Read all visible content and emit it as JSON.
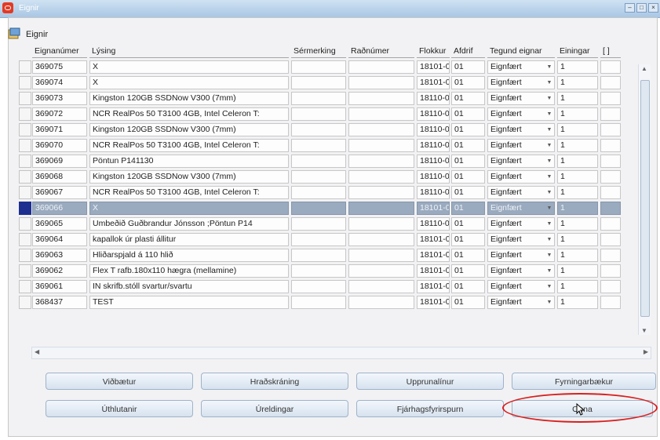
{
  "window": {
    "title": "Eignir"
  },
  "form": {
    "title": "Eignir"
  },
  "columns": [
    "Eignanúmer",
    "Lýsing",
    "Sérmerking",
    "Raðnúmer",
    "Flokkur",
    "Afdrif",
    "Tegund eignar",
    "Einingar",
    "[ ]"
  ],
  "rows": [
    {
      "num": "369075",
      "desc": "X",
      "ser": "",
      "rad": "",
      "flokkur": "18101-0",
      "afdrif": "01",
      "tegund": "Eignfært",
      "einingar": "1"
    },
    {
      "num": "369074",
      "desc": "X",
      "ser": "",
      "rad": "",
      "flokkur": "18101-0",
      "afdrif": "01",
      "tegund": "Eignfært",
      "einingar": "1"
    },
    {
      "num": "369073",
      "desc": "Kingston 120GB SSDNow V300 (7mm)",
      "ser": "",
      "rad": "",
      "flokkur": "18110-0",
      "afdrif": "01",
      "tegund": "Eignfært",
      "einingar": "1"
    },
    {
      "num": "369072",
      "desc": "NCR RealPos 50 T3100 4GB, Intel Celeron T:",
      "ser": "",
      "rad": "",
      "flokkur": "18110-0",
      "afdrif": "01",
      "tegund": "Eignfært",
      "einingar": "1"
    },
    {
      "num": "369071",
      "desc": "Kingston 120GB SSDNow V300 (7mm)",
      "ser": "",
      "rad": "",
      "flokkur": "18110-0",
      "afdrif": "01",
      "tegund": "Eignfært",
      "einingar": "1"
    },
    {
      "num": "369070",
      "desc": "NCR RealPos 50 T3100 4GB, Intel Celeron T:",
      "ser": "",
      "rad": "",
      "flokkur": "18110-0",
      "afdrif": "01",
      "tegund": "Eignfært",
      "einingar": "1"
    },
    {
      "num": "369069",
      "desc": "Pöntun P141130",
      "ser": "",
      "rad": "",
      "flokkur": "18110-0",
      "afdrif": "01",
      "tegund": "Eignfært",
      "einingar": "1"
    },
    {
      "num": "369068",
      "desc": "Kingston 120GB SSDNow V300 (7mm)",
      "ser": "",
      "rad": "",
      "flokkur": "18110-0",
      "afdrif": "01",
      "tegund": "Eignfært",
      "einingar": "1"
    },
    {
      "num": "369067",
      "desc": "NCR RealPos 50 T3100 4GB, Intel Celeron T:",
      "ser": "",
      "rad": "",
      "flokkur": "18110-0",
      "afdrif": "01",
      "tegund": "Eignfært",
      "einingar": "1"
    },
    {
      "num": "369066",
      "desc": "X",
      "ser": "",
      "rad": "",
      "flokkur": "18101-0",
      "afdrif": "01",
      "tegund": "Eignfært",
      "einingar": "1",
      "selected": true
    },
    {
      "num": "369065",
      "desc": "Umbeðið Guðbrandur Jónsson ;Pöntun P14",
      "ser": "",
      "rad": "",
      "flokkur": "18110-0",
      "afdrif": "01",
      "tegund": "Eignfært",
      "einingar": "1"
    },
    {
      "num": "369064",
      "desc": "kapallok úr plasti állitur",
      "ser": "",
      "rad": "",
      "flokkur": "18101-0",
      "afdrif": "01",
      "tegund": "Eignfært",
      "einingar": "1"
    },
    {
      "num": "369063",
      "desc": "Hliðarspjald á 110 hlið",
      "ser": "",
      "rad": "",
      "flokkur": "18101-0",
      "afdrif": "01",
      "tegund": "Eignfært",
      "einingar": "1"
    },
    {
      "num": "369062",
      "desc": "Flex T rafb.180x110 hægra (mellamine)",
      "ser": "",
      "rad": "",
      "flokkur": "18101-0",
      "afdrif": "01",
      "tegund": "Eignfært",
      "einingar": "1"
    },
    {
      "num": "369061",
      "desc": "IN skrifb.stóll svartur/svartu",
      "ser": "",
      "rad": "",
      "flokkur": "18101-0",
      "afdrif": "01",
      "tegund": "Eignfært",
      "einingar": "1"
    },
    {
      "num": "368437",
      "desc": "TEST",
      "ser": "",
      "rad": "",
      "flokkur": "18101-0",
      "afdrif": "01",
      "tegund": "Eignfært",
      "einingar": "1"
    }
  ],
  "buttons": {
    "row1": [
      "Viðbætur",
      "Hraðskráning",
      "Upprunalínur",
      "Fyrningarbækur"
    ],
    "row2": [
      "Úthlutanir",
      "Úreldingar",
      "Fjárhagsfyrirspurn",
      "Opna"
    ]
  },
  "colors": {
    "selected_row": "#9aaabf",
    "row_indicator": "#1d2f8f",
    "highlight_circle": "#d82020"
  }
}
